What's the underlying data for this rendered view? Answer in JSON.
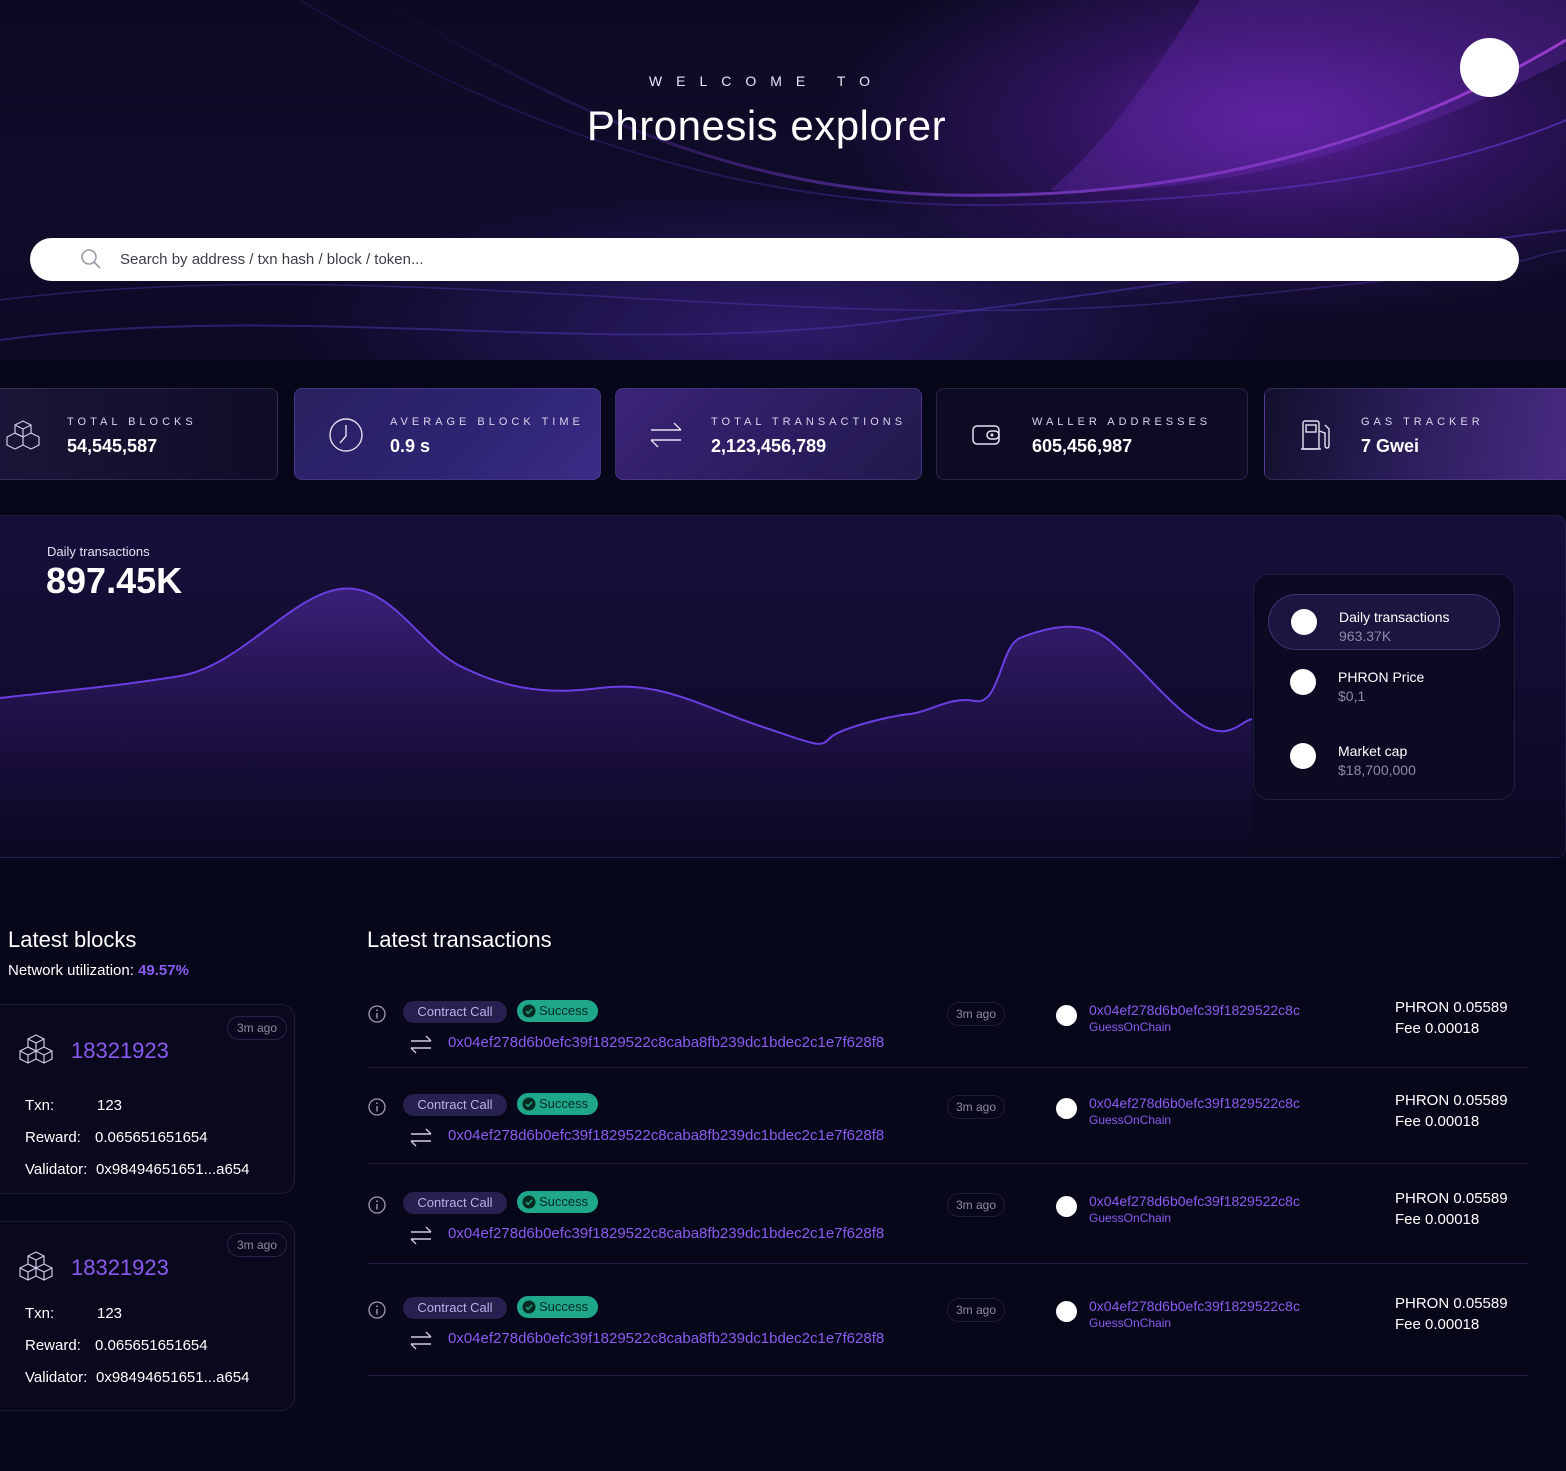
{
  "hero": {
    "welcome": "WELCOME TO",
    "title": "Phronesis explorer",
    "search_placeholder": "Search by address / txn hash / block / token..."
  },
  "stats": [
    {
      "label": "TOTAL BLOCKS",
      "value": "54,545,587",
      "icon": "blocks-icon"
    },
    {
      "label": "AVERAGE BLOCK TIME",
      "value": "0.9 s",
      "icon": "clock-icon"
    },
    {
      "label": "TOTAL TRANSACTIONS",
      "value": "2,123,456,789",
      "icon": "transfer-arrows-icon"
    },
    {
      "label": "WALLER ADDRESSES",
      "value": "605,456,987",
      "icon": "wallet-icon"
    },
    {
      "label": "GAS TRACKER",
      "value": "7 Gwei",
      "icon": "gas-pump-icon"
    }
  ],
  "chart": {
    "label": "Daily transactions",
    "value": "897.45K",
    "legend": [
      {
        "name": "Daily transactions",
        "value": "963.37K",
        "active": true
      },
      {
        "name": "PHRON Price",
        "value": "$0,1",
        "active": false
      },
      {
        "name": "Market cap",
        "value": "$18,700,000",
        "active": false
      }
    ]
  },
  "blocks": {
    "title": "Latest blocks",
    "network_label": "Network utilization: ",
    "network_value": "49.57%",
    "txn_label": "Txn:",
    "reward_label": "Reward:",
    "validator_label": "Validator:",
    "items": [
      {
        "number": "18321923",
        "ago": "3m ago",
        "txn": "123",
        "reward": "0.065651651654",
        "validator": "0x98494651651...a654"
      },
      {
        "number": "18321923",
        "ago": "3m ago",
        "txn": "123",
        "reward": "0.065651651654",
        "validator": "0x98494651651...a654"
      }
    ]
  },
  "transactions": {
    "title": "Latest transactions",
    "items": [
      {
        "type": "Contract Call",
        "status": "Success",
        "hash": "0x04ef278d6b0efc39f1829522c8caba8fb239dc1bdec2c1e7f628f8",
        "ago": "3m ago",
        "from": "0x04ef278d6b0efc39f1829522c8c",
        "from_name": "GuessOnChain",
        "amount": "PHRON 0.05589",
        "fee": "Fee 0.00018"
      },
      {
        "type": "Contract Call",
        "status": "Success",
        "hash": "0x04ef278d6b0efc39f1829522c8caba8fb239dc1bdec2c1e7f628f8",
        "ago": "3m ago",
        "from": "0x04ef278d6b0efc39f1829522c8c",
        "from_name": "GuessOnChain",
        "amount": "PHRON 0.05589",
        "fee": "Fee 0.00018"
      },
      {
        "type": "Contract Call",
        "status": "Success",
        "hash": "0x04ef278d6b0efc39f1829522c8caba8fb239dc1bdec2c1e7f628f8",
        "ago": "3m ago",
        "from": "0x04ef278d6b0efc39f1829522c8c",
        "from_name": "GuessOnChain",
        "amount": "PHRON 0.05589",
        "fee": "Fee 0.00018"
      },
      {
        "type": "Contract Call",
        "status": "Success",
        "hash": "0x04ef278d6b0efc39f1829522c8caba8fb239dc1bdec2c1e7f628f8",
        "ago": "3m ago",
        "from": "0x04ef278d6b0efc39f1829522c8c",
        "from_name": "GuessOnChain",
        "amount": "PHRON 0.05589",
        "fee": "Fee 0.00018"
      }
    ]
  },
  "colors": {
    "accent": "#8a5bf0",
    "success": "#1fa78a",
    "background": "#07071a"
  }
}
